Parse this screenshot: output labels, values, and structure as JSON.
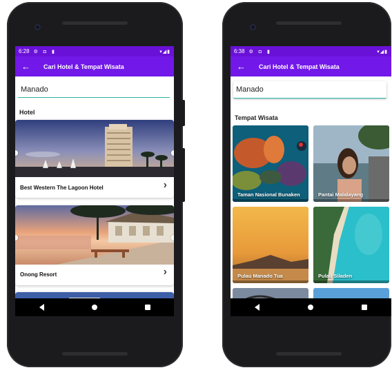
{
  "left_phone": {
    "status": {
      "time": "6:28",
      "icons": "⚙ ◘ ▮",
      "right_icons": "▾◢▮"
    },
    "appbar": {
      "back_icon": "←",
      "title": "Cari Hotel & Tempat Wisata"
    },
    "search": {
      "value": "Manado"
    },
    "section_title": "Hotel",
    "hotels": [
      {
        "name": "Best Western The Lagoon Hotel",
        "chevron": "›"
      },
      {
        "name": "Onong Resort",
        "chevron": "›"
      },
      {
        "name": "",
        "chevron": ""
      }
    ]
  },
  "right_phone": {
    "status": {
      "time": "6:38",
      "icons": "⚙ ◘ ▮",
      "right_icons": "▾◢▮"
    },
    "appbar": {
      "back_icon": "←",
      "title": "Cari Hotel & Tempat Wisata"
    },
    "search": {
      "value": "Manado"
    },
    "section_title": "Tempat Wisata",
    "places": [
      {
        "name": "Taman Nasional Bunaken"
      },
      {
        "name": "Pantai Malalayang"
      },
      {
        "name": "Pulau Manado Tua"
      },
      {
        "name": "Pulau Siladen"
      },
      {
        "name": ""
      },
      {
        "name": ""
      }
    ]
  },
  "colors": {
    "status_bar": "#6a11d8",
    "app_bar": "#7218e8",
    "input_underline": "#2bb3a8"
  }
}
